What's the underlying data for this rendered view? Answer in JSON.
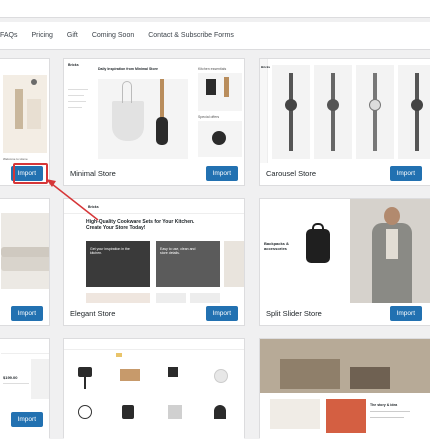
{
  "filters": [
    "FAQs",
    "Pricing",
    "Gift",
    "Coming Soon",
    "Contact & Subscribe Forms"
  ],
  "cards": [
    {
      "title": "",
      "button": "Import"
    },
    {
      "title": "Minimal Store",
      "button": "Import"
    },
    {
      "title": "Carousel Store",
      "button": "Import"
    },
    {
      "title": "",
      "button": "Import"
    },
    {
      "title": "Elegant Store",
      "button": "Import"
    },
    {
      "title": "Split Slider Store",
      "button": "Import"
    },
    {
      "title": "",
      "button": "Import"
    },
    {
      "title": "",
      "button": ""
    },
    {
      "title": "",
      "button": ""
    }
  ],
  "thumb_text": {
    "minimal_brand": "Bricks",
    "minimal_headline": "Daily Inspiration from Minimal Store",
    "minimal_side1": "Kitchen essentials",
    "minimal_side2": "Special offers",
    "carousel_brand": "Bricks",
    "elegant_brand": "Bricks",
    "elegant_headline": "High-Quality Cookware Sets for Your Kitchen. Create Your Store Today!",
    "elegant_box1": "Get your inspiration in the kitchen.",
    "elegant_box2": "Easy to use, clean and store details.",
    "split_headline": "Backpacks & accessories",
    "card1_label": "Welcome to Home",
    "card7_price": "$199.00",
    "card9_text": "The story & idea"
  },
  "colors": {
    "accent": "#2271b1",
    "highlight": "#d63638",
    "background": "#f0f0f1"
  }
}
